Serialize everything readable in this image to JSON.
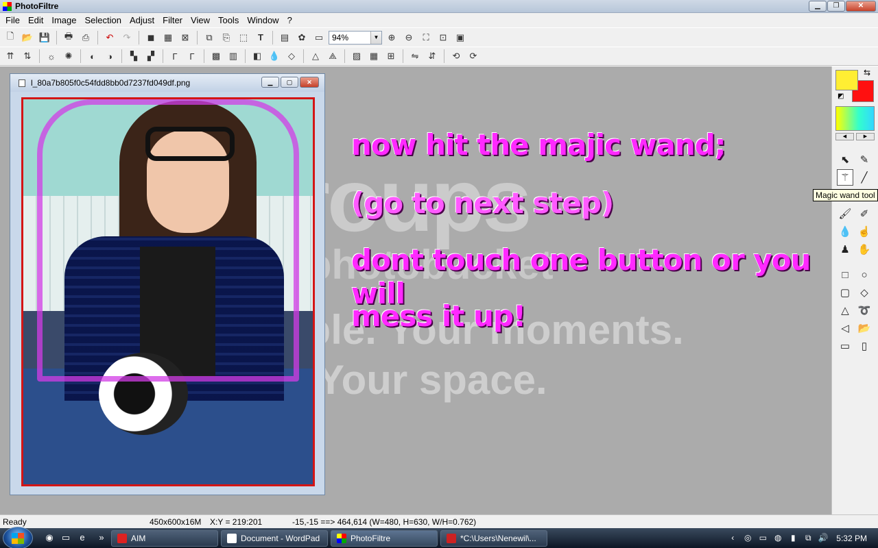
{
  "window": {
    "title": "PhotoFiltre"
  },
  "menu": [
    "File",
    "Edit",
    "Image",
    "Selection",
    "Adjust",
    "Filter",
    "View",
    "Tools",
    "Window",
    "?"
  ],
  "toolbar1": {
    "zoom_value": "94%"
  },
  "document": {
    "title": "l_80a7b805f0c54fdd8bb0d7237fd049df.png"
  },
  "watermark": {
    "logo": "groups",
    "byline": "by photobucket",
    "tagline1": "Your people. Your moments.",
    "tagline2": "Your space."
  },
  "overlay_text": {
    "line1": "now hit the majic wand;",
    "line2": "(go to next step)",
    "line3": "dont touch one button or you will",
    "line4": "mess it up!"
  },
  "palette": {
    "foreground_color": "#ffee33",
    "background_color": "#ff1010",
    "tooltip": "Magic wand tool"
  },
  "status": {
    "state": "Ready",
    "image_info": "450x600x16M",
    "cursor": "X:Y = 219:201",
    "selection": "-15,-15 ==> 464,614 (W=480, H=630, W/H=0.762)"
  },
  "taskbar": {
    "tasks": [
      {
        "label": "AIM"
      },
      {
        "label": "Document - WordPad"
      },
      {
        "label": "PhotoFiltre"
      },
      {
        "label": "*C:\\Users\\Nenewil\\..."
      }
    ],
    "clock": "5:32 PM"
  }
}
